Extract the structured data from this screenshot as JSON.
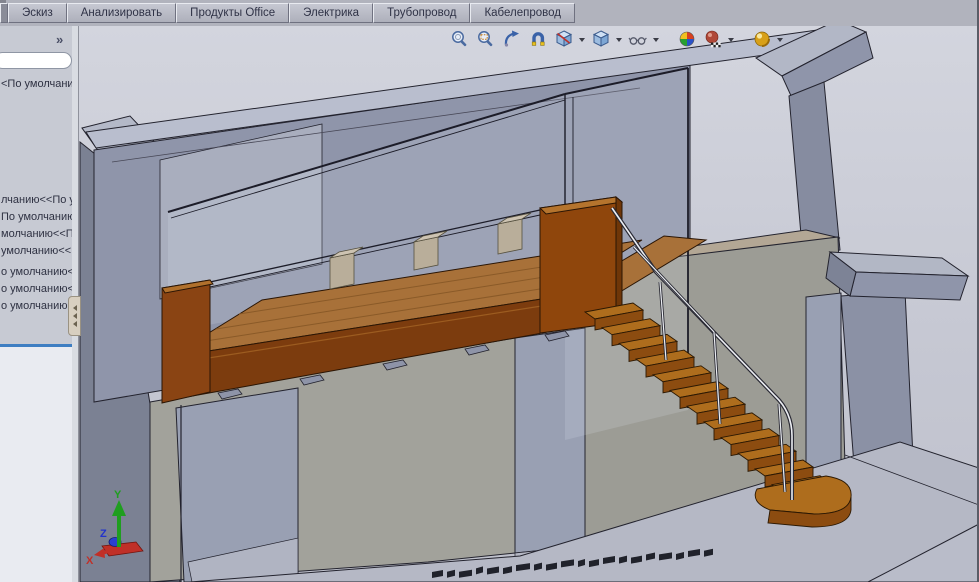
{
  "tab_bar": {
    "tabs": [
      {
        "label": "Эскиз"
      },
      {
        "label": "Анализировать"
      },
      {
        "label": "Продукты Office"
      },
      {
        "label": "Электрика"
      },
      {
        "label": "Трубопровод"
      },
      {
        "label": "Кабелепровод"
      }
    ]
  },
  "left_panel": {
    "collapse_chevron": "»",
    "config_filter_value": "",
    "default_label": "<По умолчанию",
    "tree_items": [
      "лчанию<<По у",
      "По умолчанию<",
      "молчанию<<По",
      "умолчанию<<П",
      "о умолчанию<<",
      "о умолчанию<<",
      "о умолчанию<<"
    ]
  },
  "view_toolbar": {
    "icons": [
      {
        "name": "zoom-to-fit",
        "dropdown": false
      },
      {
        "name": "zoom-to-area",
        "dropdown": false
      },
      {
        "name": "rotate-view",
        "dropdown": false
      },
      {
        "name": "pan",
        "dropdown": false
      },
      {
        "name": "section-view",
        "dropdown": true
      },
      {
        "name": "view-orientation",
        "dropdown": true
      },
      {
        "name": "display-style",
        "dropdown": true
      },
      {
        "name": "realview",
        "dropdown": false
      },
      {
        "name": "edit-appearance",
        "dropdown": true
      },
      {
        "name": "apply-scene",
        "dropdown": true
      }
    ]
  },
  "viewport": {
    "triad": {
      "x_label": "X",
      "y_label": "Y",
      "z_label": "Z"
    },
    "colors": {
      "background": "#ccced8",
      "walls": "#8f95aa",
      "lower_wall": "#a2a29b",
      "wood_floor": "#a87139",
      "fascia": "#7c3c0e",
      "stairs": "#ae6d1d",
      "glass_edge": "#1c1c28",
      "railing": "#eceef3",
      "triad_x": "#c03028",
      "triad_y": "#1f9e1f",
      "triad_z": "#2233cc"
    }
  }
}
